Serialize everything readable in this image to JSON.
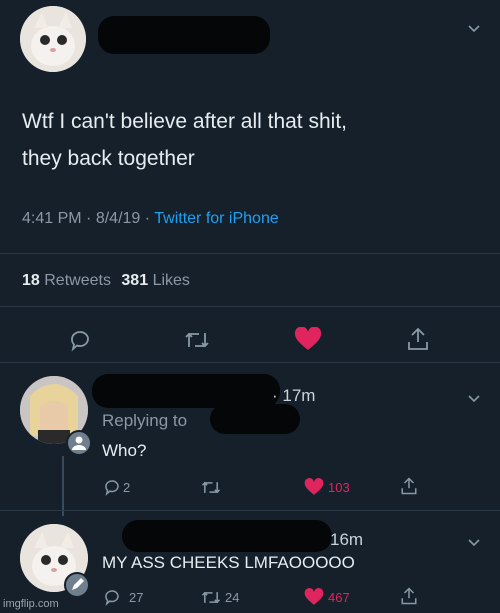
{
  "main_tweet": {
    "text_line1": "Wtf I can't believe after all that shit,",
    "text_line2": "they back together",
    "time": "4:41 PM",
    "sep1": "·",
    "date": "8/4/19",
    "sep2": "·",
    "client": "Twitter for iPhone",
    "retweets_count": "18",
    "retweets_label": "Retweets",
    "likes_count": "381",
    "likes_label": "Likes"
  },
  "reply1": {
    "time": "· 17m",
    "replying_to_label": "Replying to",
    "text": "Who?",
    "reply_count": "2",
    "like_count": "103"
  },
  "reply2": {
    "time": "16m",
    "text": "MY ASS CHEEKS LMFAOOOOO",
    "reply_count": "27",
    "retweet_count": "24",
    "like_count": "467"
  },
  "watermark": "imgflip.com",
  "colors": {
    "background": "#15202b",
    "accent": "#1da1f2",
    "like": "#e0245e"
  },
  "icons": [
    "chevron-down-icon",
    "reply-icon",
    "retweet-icon",
    "heart-icon",
    "share-icon",
    "verified-badge-icon",
    "edit-badge-icon"
  ]
}
